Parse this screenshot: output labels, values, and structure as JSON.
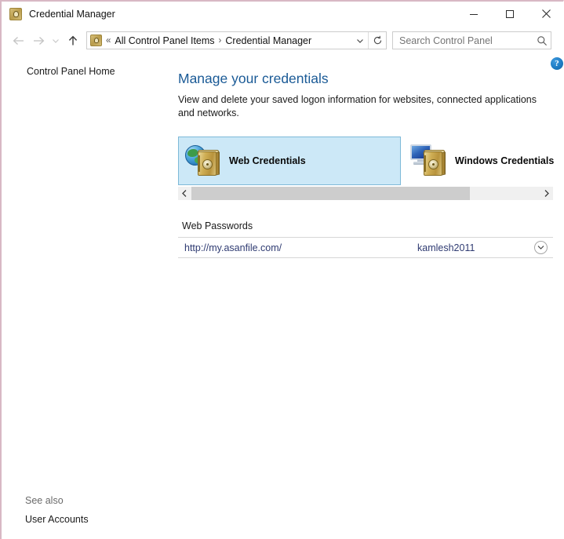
{
  "window": {
    "title": "Credential Manager",
    "icon": "credential-manager-icon",
    "controls": {
      "minimize": "Minimize",
      "maximize": "Maximize",
      "close": "Close"
    }
  },
  "navbar": {
    "back": "Back",
    "forward": "Forward",
    "recent": "Recent locations",
    "up": "Up one level",
    "breadcrumb": {
      "leading_separator": "«",
      "items": [
        {
          "label": "All Control Panel Items"
        },
        {
          "label": "Credential Manager"
        }
      ],
      "separator": "›"
    },
    "dropdown": "Previous locations",
    "refresh": "Refresh",
    "search": {
      "placeholder": "Search Control Panel",
      "value": "",
      "icon": "search-icon"
    }
  },
  "sidebar": {
    "home_label": "Control Panel Home",
    "see_also_label": "See also",
    "see_also_items": [
      {
        "label": "User Accounts"
      }
    ]
  },
  "help": {
    "label": "?",
    "tooltip": "Help"
  },
  "main": {
    "title": "Manage your credentials",
    "description": "View and delete your saved logon information for websites, connected applications and networks.",
    "tiles": [
      {
        "label": "Web Credentials",
        "icon": "globe-vault-icon",
        "selected": true
      },
      {
        "label": "Windows Credentials",
        "icon": "monitor-vault-icon",
        "selected": false
      }
    ],
    "scrollbar": {
      "left_arrow": "‹",
      "right_arrow": "›",
      "thumb_percent": 80
    },
    "section_title": "Web Passwords",
    "credentials": [
      {
        "url": "http://my.asanfile.com/",
        "username": "kamlesh2011",
        "expand_icon": "chevron-down-icon"
      }
    ]
  },
  "colors": {
    "accent_title": "#1a5a96",
    "selection_bg": "#cce8f7",
    "selection_border": "#7eb9d8",
    "link_text": "#2f3b72",
    "help_blue": "#1e7cc4",
    "window_edge": "#d8b8c4"
  }
}
